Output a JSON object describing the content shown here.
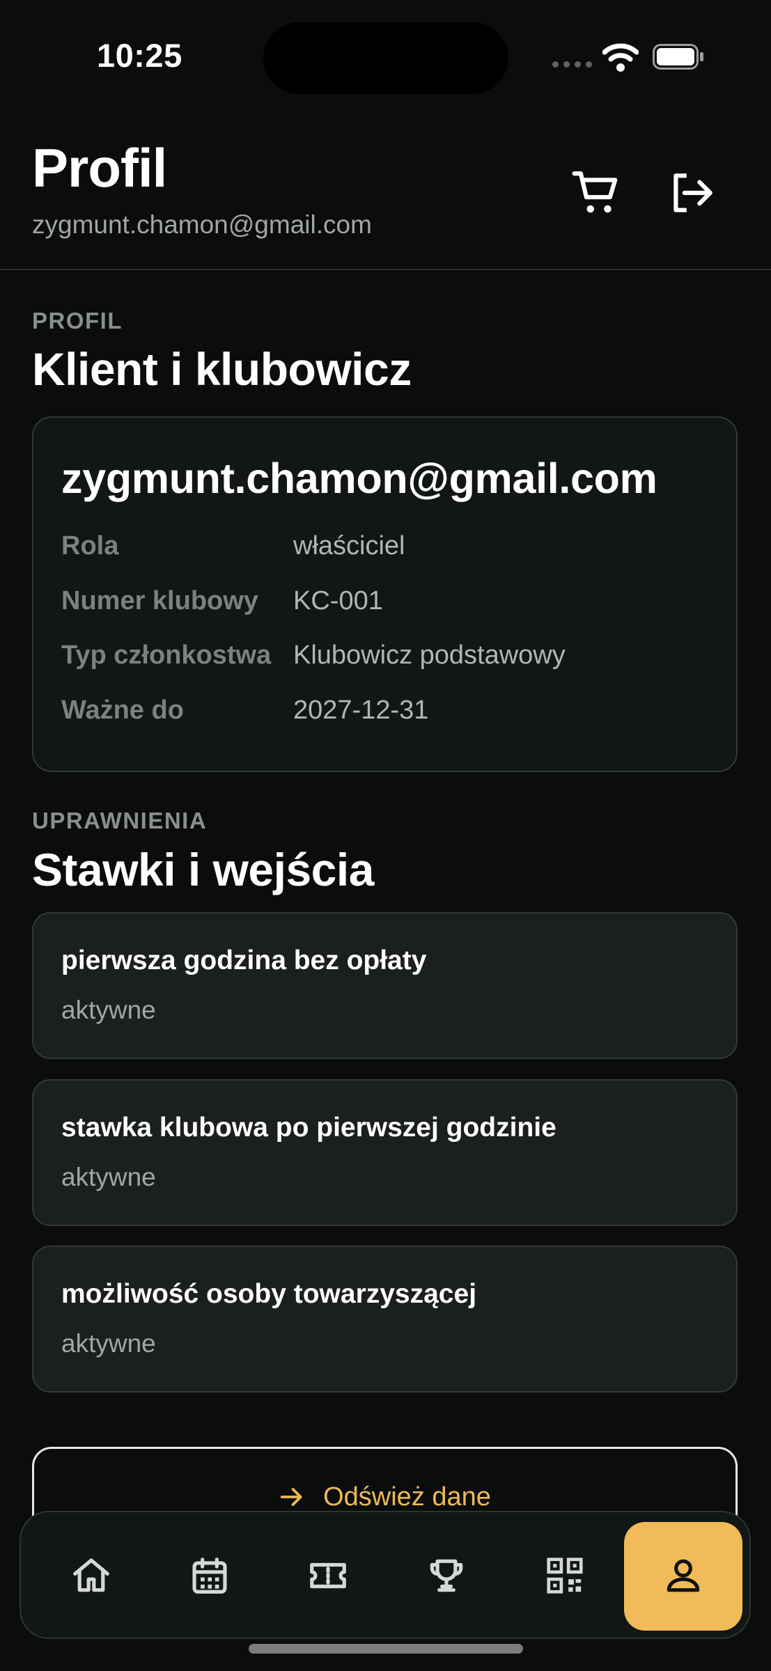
{
  "status_bar": {
    "time": "10:25"
  },
  "header": {
    "title": "Profil",
    "email": "zygmunt.chamon@gmail.com"
  },
  "profile_section": {
    "eyebrow": "PROFIL",
    "title": "Klient i klubowicz",
    "card": {
      "email": "zygmunt.chamon@gmail.com",
      "rows": [
        {
          "label": "Rola",
          "value": "właściciel"
        },
        {
          "label": "Numer klubowy",
          "value": "KC-001"
        },
        {
          "label": "Typ członkostwa",
          "value": "Klubowicz podstawowy"
        },
        {
          "label": "Ważne do",
          "value": "2027-12-31"
        }
      ]
    }
  },
  "permissions_section": {
    "eyebrow": "UPRAWNIENIA",
    "title": "Stawki i wejścia",
    "items": [
      {
        "title": "pierwsza godzina bez opłaty",
        "status": "aktywne"
      },
      {
        "title": "stawka klubowa po pierwszej godzinie",
        "status": "aktywne"
      },
      {
        "title": "możliwość osoby towarzyszącej",
        "status": "aktywne"
      }
    ]
  },
  "refresh_button": {
    "label": "Odśwież dane",
    "icon": "arrow-right-icon"
  },
  "bottom_nav": {
    "active": "profile",
    "items": [
      {
        "icon": "home-icon"
      },
      {
        "icon": "calendar-icon"
      },
      {
        "icon": "ticket-icon"
      },
      {
        "icon": "trophy-icon"
      },
      {
        "icon": "qr-code-icon"
      },
      {
        "icon": "user-icon"
      }
    ]
  },
  "colors": {
    "background": "#0b0c0c",
    "card": "#121615",
    "item": "#1b1f1e",
    "accent": "#f0bb58",
    "muted": "#a2a6a5"
  }
}
